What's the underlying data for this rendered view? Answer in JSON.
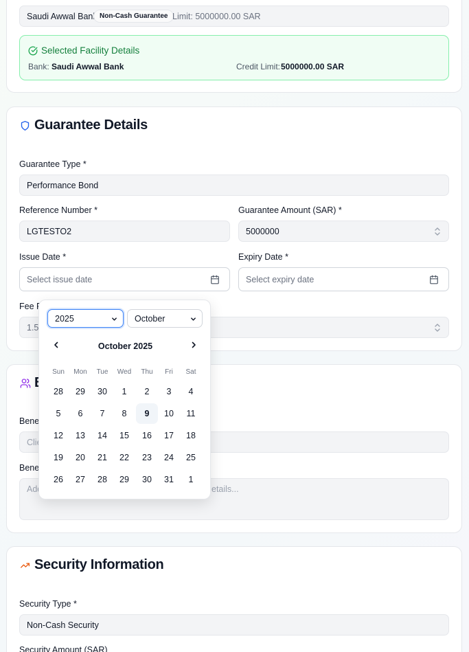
{
  "facility": {
    "bank_name": "Saudi Awwal Bank",
    "badge": "Non-Cash Guarantee",
    "limit": "Limit: 5000000.00 SAR",
    "selected_title": "Selected Facility Details",
    "bank_label": "Bank:",
    "bank_value": "Saudi Awwal Bank",
    "credit_label": "Credit Limit:",
    "credit_value": "5000000.00 SAR"
  },
  "guarantee": {
    "title": "Guarantee Details",
    "type_label": "Guarantee Type *",
    "type_value": "Performance Bond",
    "ref_label": "Reference Number *",
    "ref_value": "LGTESTO2",
    "amount_label": "Guarantee Amount (SAR) *",
    "amount_value": "5000000",
    "issue_label": "Issue Date *",
    "issue_placeholder": "Select issue date",
    "expiry_label": "Expiry Date *",
    "expiry_placeholder": "Select expiry date",
    "fee_label_partial": "Fee R",
    "fee_value": "1.5"
  },
  "beneficiary": {
    "title_partial": "B",
    "name_label_partial": "Benef",
    "name_placeholder_partial": "Clie",
    "details_label_partial": "Benef",
    "details_placeholder_left": "Add",
    "details_placeholder_right": "etails..."
  },
  "security": {
    "title": "Security Information",
    "type_label": "Security Type *",
    "type_value": "Non-Cash Security",
    "amount_label_partial": "Security Amount (SAR)"
  },
  "calendar": {
    "year": "2025",
    "month": "October",
    "caption": "October 2025",
    "weekdays": [
      "Sun",
      "Mon",
      "Tue",
      "Wed",
      "Thu",
      "Fri",
      "Sat"
    ],
    "weeks": [
      [
        "28",
        "29",
        "30",
        "1",
        "2",
        "3",
        "4"
      ],
      [
        "5",
        "6",
        "7",
        "8",
        "9",
        "10",
        "11"
      ],
      [
        "12",
        "13",
        "14",
        "15",
        "16",
        "17",
        "18"
      ],
      [
        "19",
        "20",
        "21",
        "22",
        "23",
        "24",
        "25"
      ],
      [
        "26",
        "27",
        "28",
        "29",
        "30",
        "31",
        "1"
      ]
    ],
    "today": "9"
  },
  "colors": {
    "accent_blue": "#2563eb",
    "accent_green": "#16a34a",
    "accent_purple": "#9333ea",
    "accent_orange": "#ea580c"
  }
}
